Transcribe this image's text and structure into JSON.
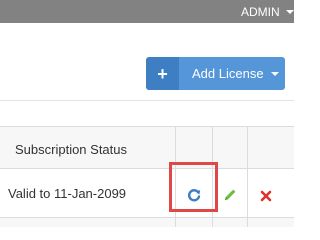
{
  "header": {
    "user_menu_label": "ADMIN"
  },
  "toolbar": {
    "add_plus_label": "+",
    "add_license_label": "Add License"
  },
  "table": {
    "columns": [
      "Subscription Status"
    ],
    "rows": [
      {
        "subscription_status": "Valid to 11-Jan-2099",
        "actions": [
          "refresh-icon",
          "edit-pencil-icon",
          "delete-x-icon"
        ]
      }
    ]
  },
  "colors": {
    "topbar": "#828282",
    "primary_button": "#5596d9",
    "primary_button_dark": "#3e7ec3",
    "refresh_icon": "#3e7ec3",
    "edit_icon": "#6cbf3b",
    "delete_icon": "#e0312e",
    "highlight_box": "#e04848"
  }
}
